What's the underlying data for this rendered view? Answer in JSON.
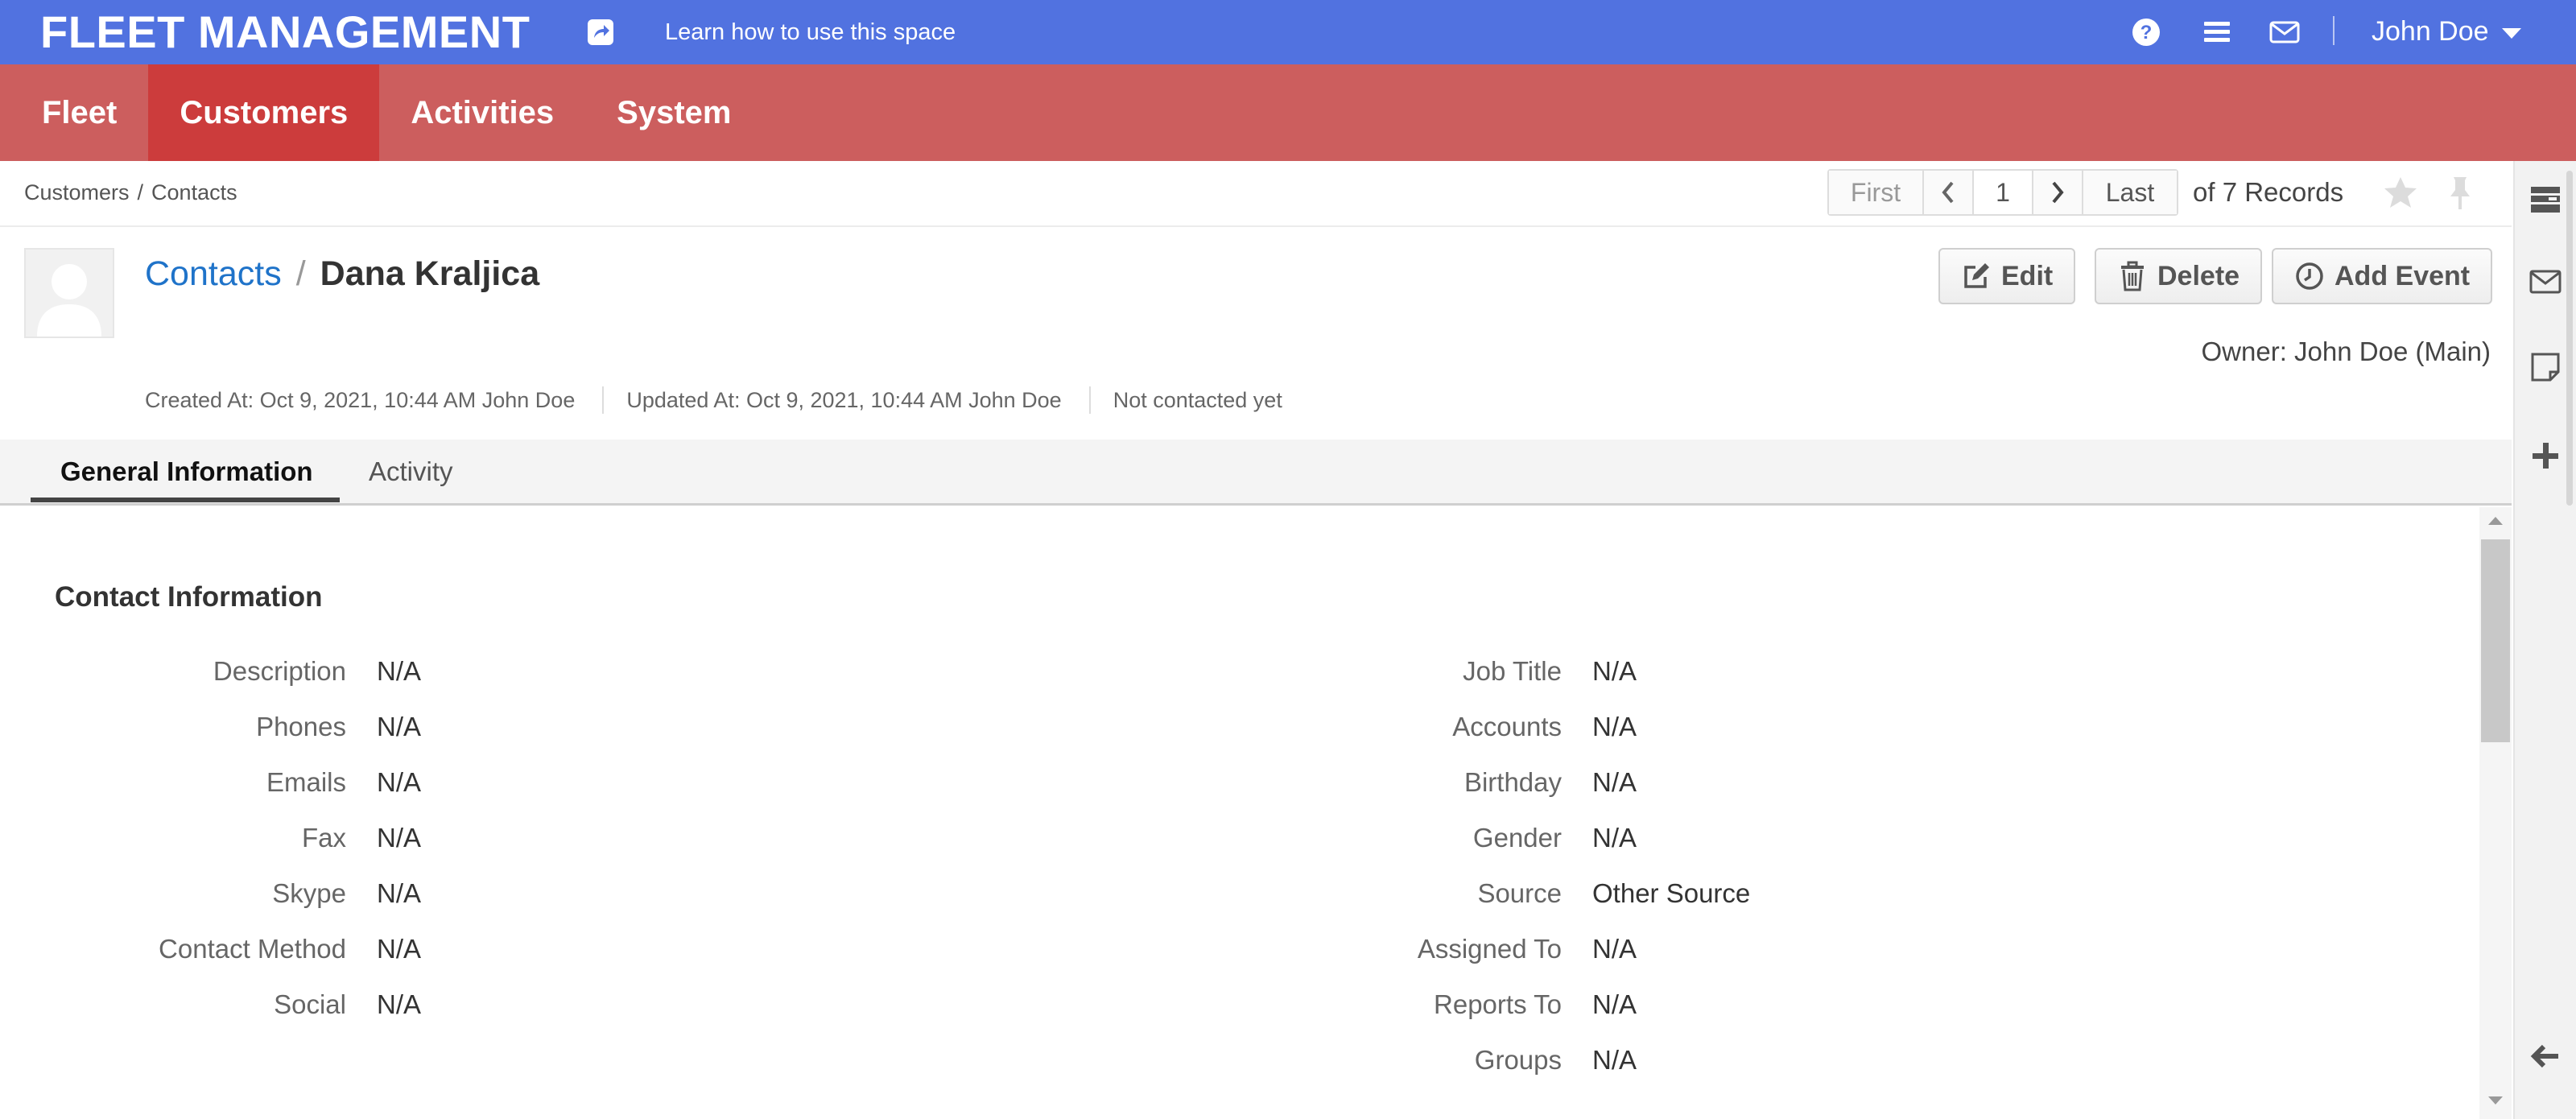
{
  "topbar": {
    "brand": "FLEET MANAGEMENT",
    "learn_link": "Learn how to use this space",
    "user_name": "John Doe",
    "colors": {
      "topbar": "#5172e0",
      "nav": "#cc5e5e",
      "nav_active": "#cc3c3c",
      "link": "#1f73c9"
    }
  },
  "nav": {
    "items": [
      "Fleet",
      "Customers",
      "Activities",
      "System"
    ],
    "active": "Customers"
  },
  "breadcrumb": [
    "Customers",
    "Contacts"
  ],
  "breadcrumb_sep": "/",
  "pager": {
    "first": "First",
    "page": "1",
    "last": "Last",
    "records": "of 7 Records"
  },
  "header": {
    "entity_link": "Contacts",
    "sep": "/",
    "name": "Dana Kraljica",
    "buttons": {
      "edit": "Edit",
      "delete": "Delete",
      "add_event": "Add Event"
    },
    "owner": "Owner: John Doe (Main)",
    "created": "Created At: Oct 9, 2021, 10:44 AM John Doe",
    "updated": "Updated At: Oct 9, 2021, 10:44 AM John Doe",
    "contacted": "Not contacted yet"
  },
  "tabs": [
    "General Information",
    "Activity"
  ],
  "section": {
    "title": "Contact Information",
    "left": [
      {
        "label": "Description",
        "value": "N/A"
      },
      {
        "label": "Phones",
        "value": "N/A"
      },
      {
        "label": "Emails",
        "value": "N/A"
      },
      {
        "label": "Fax",
        "value": "N/A"
      },
      {
        "label": "Skype",
        "value": "N/A"
      },
      {
        "label": "Contact Method",
        "value": "N/A"
      },
      {
        "label": "Social",
        "value": "N/A"
      }
    ],
    "right": [
      {
        "label": "Job Title",
        "value": "N/A"
      },
      {
        "label": "Accounts",
        "value": "N/A"
      },
      {
        "label": "Birthday",
        "value": "N/A"
      },
      {
        "label": "Gender",
        "value": "N/A"
      },
      {
        "label": "Source",
        "value": "Other Source"
      },
      {
        "label": "Assigned To",
        "value": "N/A"
      },
      {
        "label": "Reports To",
        "value": "N/A"
      },
      {
        "label": "Groups",
        "value": "N/A"
      }
    ]
  },
  "icons": [
    "share-icon",
    "help-icon",
    "menu-icon",
    "mail-icon",
    "star-icon",
    "pin-icon",
    "avatar-icon",
    "edit-icon",
    "trash-icon",
    "clock-icon",
    "panel-icon",
    "sidebar-mail-icon",
    "note-icon",
    "plus-icon",
    "back-arrow-icon"
  ]
}
